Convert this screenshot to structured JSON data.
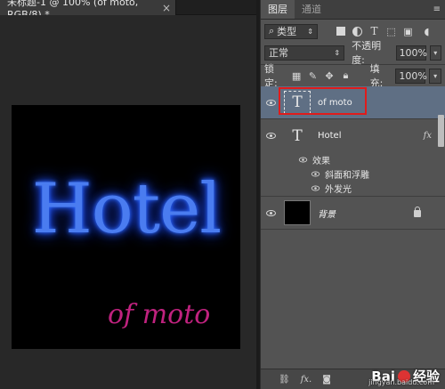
{
  "document_tab": {
    "title": "未标题-1 @ 100% (of moto, RGB/8) *",
    "close": "×"
  },
  "canvas": {
    "hotel_text": "Hotel",
    "moto_text": "of moto",
    "glow_color": "#2255ff",
    "moto_color": "#c0227f"
  },
  "panel": {
    "tabs": [
      "图层",
      "通道"
    ],
    "menu": "≡",
    "filter": {
      "icon": "search-icon",
      "label": "类型"
    },
    "blend_mode": "正常",
    "opacity_label": "不透明度:",
    "opacity_value": "100%",
    "lock_label": "锁定:",
    "fill_label": "填充:",
    "fill_value": "100%",
    "arrow": "▾"
  },
  "layers": [
    {
      "name": "of moto",
      "type": "text",
      "selected": true
    },
    {
      "name": "Hotel",
      "type": "text",
      "fx": "fx"
    },
    {
      "name": "背景",
      "type": "background",
      "locked": true
    }
  ],
  "effects": {
    "label": "效果",
    "items": [
      "斜面和浮雕",
      "外发光"
    ]
  },
  "bottom_bar": {
    "fx": "fx."
  },
  "watermark": {
    "brand": "Bai",
    "brand2": "经验",
    "sub": "jingyan.baidu.com"
  }
}
